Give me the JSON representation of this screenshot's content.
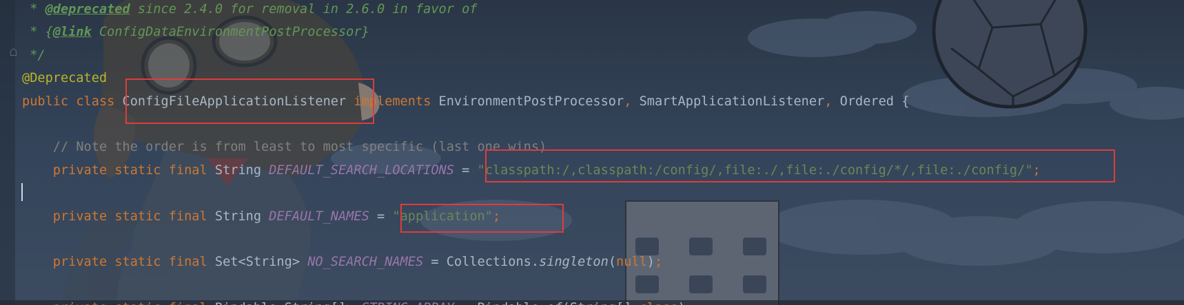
{
  "theme": {
    "background": "#2c3a4c",
    "highlight_box_color": "#e03c3c",
    "colors": {
      "keyword": "#cc7832",
      "string": "#6a8759",
      "field": "#9876aa",
      "annotation": "#bbb529",
      "plain": "#a9b7c6",
      "comment": "#808080",
      "doc_comment": "#629755"
    }
  },
  "background_image": "anime-character-artwork",
  "code_lines": [
    [
      {
        "cls": "t-doc",
        "text": " * "
      },
      {
        "cls": "t-doctag",
        "text": "@deprecated"
      },
      {
        "cls": "t-doc",
        "text": " since 2.4.0 for removal in 2.6.0 in favor of"
      }
    ],
    [
      {
        "cls": "t-doc",
        "text": " * {"
      },
      {
        "cls": "t-doctag",
        "text": "@link"
      },
      {
        "cls": "t-doclink",
        "text": " ConfigDataEnvironmentPostProcessor"
      },
      {
        "cls": "t-doc",
        "text": "}"
      }
    ],
    [
      {
        "cls": "t-doc",
        "text": " */"
      }
    ],
    [
      {
        "cls": "t-ann",
        "text": "@Deprecated"
      }
    ],
    [
      {
        "cls": "t-kw",
        "text": "public class "
      },
      {
        "cls": "t-plain",
        "text": "ConfigFileApplicationListener "
      },
      {
        "cls": "t-kw",
        "text": "implements "
      },
      {
        "cls": "t-plain",
        "text": "EnvironmentPostProcessor"
      },
      {
        "cls": "t-kw",
        "text": ", "
      },
      {
        "cls": "t-plain",
        "text": "SmartApplicationListener"
      },
      {
        "cls": "t-kw",
        "text": ", "
      },
      {
        "cls": "t-plain",
        "text": "Ordered {"
      }
    ],
    [],
    [
      {
        "cls": "t-comment",
        "text": "    // Note the order is from least to most specific (last one wins)"
      }
    ],
    [
      {
        "cls": "t-kw",
        "text": "    private static final "
      },
      {
        "cls": "t-plain",
        "text": "String "
      },
      {
        "cls": "t-field",
        "text": "DEFAULT_SEARCH_LOCATIONS"
      },
      {
        "cls": "t-plain",
        "text": " = "
      },
      {
        "cls": "t-str",
        "text": "\"classpath:/,classpath:/config/,file:./,file:./config/*/,file:./config/\""
      },
      {
        "cls": "t-kw",
        "text": ";"
      }
    ],
    [],
    [
      {
        "cls": "t-kw",
        "text": "    private static final "
      },
      {
        "cls": "t-plain",
        "text": "String "
      },
      {
        "cls": "t-field",
        "text": "DEFAULT_NAMES"
      },
      {
        "cls": "t-plain",
        "text": " = "
      },
      {
        "cls": "t-str",
        "text": "\"application\""
      },
      {
        "cls": "t-kw",
        "text": ";"
      }
    ],
    [],
    [
      {
        "cls": "t-kw",
        "text": "    private static final "
      },
      {
        "cls": "t-plain",
        "text": "Set<String> "
      },
      {
        "cls": "t-field",
        "text": "NO_SEARCH_NAMES"
      },
      {
        "cls": "t-plain",
        "text": " = Collections."
      },
      {
        "cls": "t-static-call",
        "text": "singleton"
      },
      {
        "cls": "t-plain",
        "text": "("
      },
      {
        "cls": "t-kw",
        "text": "null"
      },
      {
        "cls": "t-plain",
        "text": ")"
      },
      {
        "cls": "t-kw",
        "text": ";"
      }
    ],
    [],
    [
      {
        "cls": "t-kw",
        "text": "    private static final "
      },
      {
        "cls": "t-plain",
        "text": "Bindable<String[]> "
      },
      {
        "cls": "t-field",
        "text": "STRING_ARRAY"
      },
      {
        "cls": "t-plain",
        "text": " = Bindable."
      },
      {
        "cls": "t-static-call",
        "text": "of"
      },
      {
        "cls": "t-plain",
        "text": "(String[]."
      },
      {
        "cls": "t-kw",
        "text": "class"
      },
      {
        "cls": "t-plain",
        "text": ");"
      }
    ]
  ]
}
